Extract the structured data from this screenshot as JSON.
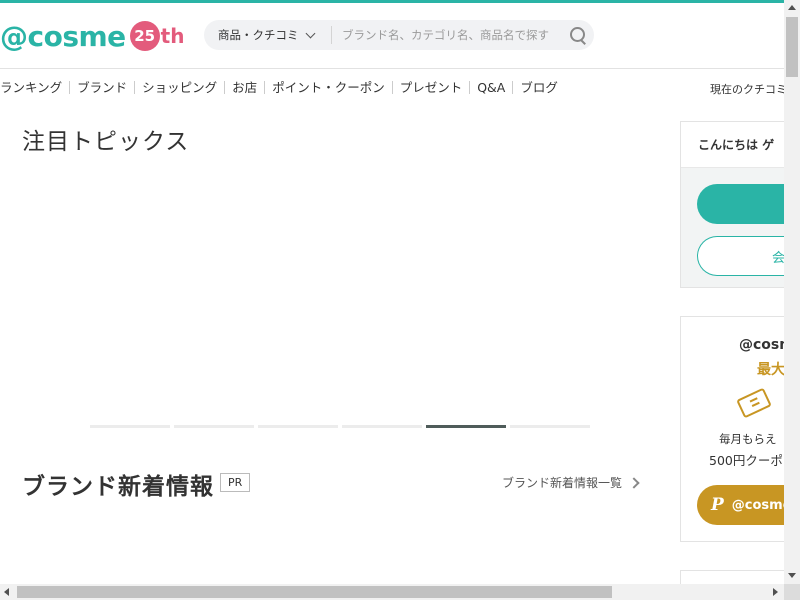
{
  "header": {
    "logo_text": "@cosme",
    "logo_anniv_number": "25",
    "logo_anniv_suffix": "th",
    "accent_color": "#2ab4a6",
    "anniv_color": "#e35b7c"
  },
  "search": {
    "category_label": "商品・クチコミ",
    "placeholder": "ブランド名、カテゴリ名、商品名で探す",
    "value": ""
  },
  "nav": {
    "items": [
      "ランキング",
      "ブランド",
      "ショッピング",
      "お店",
      "ポイント・クーポン",
      "プレゼント",
      "Q&A",
      "ブログ"
    ],
    "right_text": "現在のクチコミ"
  },
  "main": {
    "topics_title": "注目トピックス",
    "carousel": {
      "count": 6,
      "active_index": 4
    },
    "brand_title": "ブランド新着情報",
    "pr_label": "PR",
    "brand_link_label": "ブランド新着情報一覧"
  },
  "sidebar": {
    "greeting": "こんにちは ゲ",
    "login_button_label": "",
    "register_button_label": "会",
    "promo_title": "@cosm",
    "promo_subtitle": "最大",
    "promo_line1": "毎月もらえ",
    "promo_line2": "500円クーポ",
    "promo_button_label": "@cosme",
    "promo_color": "#c89623"
  },
  "icons": {
    "search": "search-icon",
    "dropdown": "chevron-down-icon",
    "link_arrow": "chevron-right-icon",
    "coupon": "ticket-icon"
  }
}
